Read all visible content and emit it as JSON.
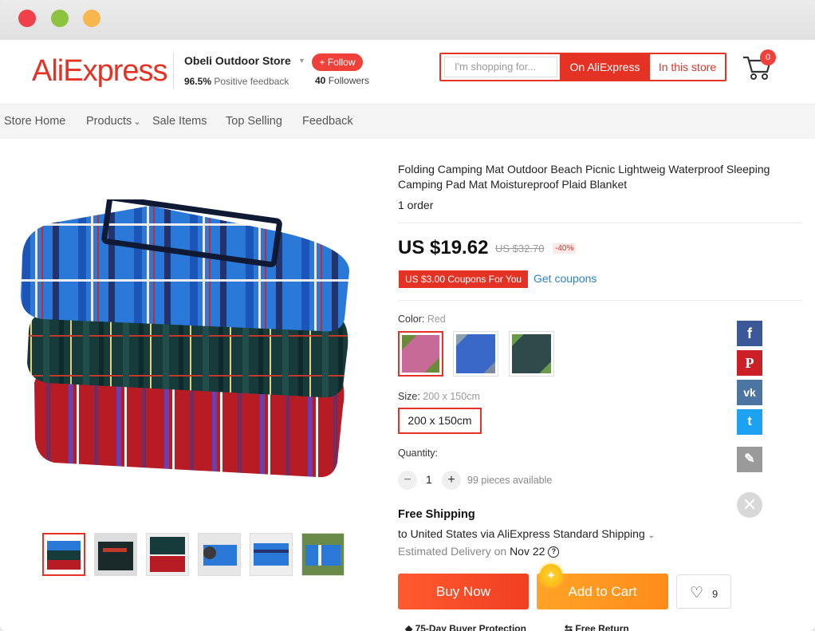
{
  "header": {
    "logo": "AliExpress",
    "store_name": "Obeli Outdoor Store",
    "follow_label": "+ Follow",
    "feedback_percent": "96.5%",
    "feedback_text": "Positive feedback",
    "followers_count": "40",
    "followers_text": "Followers",
    "search_placeholder": "I'm shopping for...",
    "search_on_ali": "On AliExpress",
    "search_in_store": "In this store",
    "cart_count": "0"
  },
  "nav": {
    "items": [
      "Store Home",
      "Products",
      "Sale Items",
      "Top Selling",
      "Feedback"
    ]
  },
  "product": {
    "title": "Folding Camping Mat Outdoor Beach Picnic Lightweig Waterproof Sleeping Camping Pad Mat Moistureproof Plaid Blanket",
    "orders": "1 order",
    "price": "US $19.62",
    "old_price": "US $32.70",
    "discount": "-40%",
    "coupon_tag": "US $3.00 Coupons For You",
    "get_coupons": "Get coupons",
    "color_label": "Color:",
    "color_value": "Red",
    "size_label": "Size:",
    "size_value": "200 x 150cm",
    "size_option": "200 x 150cm",
    "quantity_label": "Quantity:",
    "quantity_minus": "−",
    "quantity": "1",
    "quantity_plus": "+",
    "available": "99 pieces available"
  },
  "shipping": {
    "title": "Free Shipping",
    "to": "to United States via AliExpress Standard Shipping",
    "est_label": "Estimated Delivery on",
    "est_date": "Nov 22",
    "help": "?"
  },
  "actions": {
    "buy_now": "Buy Now",
    "add_to_cart": "Add to Cart",
    "wishlist_count": "9"
  },
  "protection": {
    "buyer": "75-Day Buyer Protection",
    "return": "Free Return"
  },
  "social": [
    "f",
    "P",
    "vk",
    "t",
    "✎"
  ],
  "colors": {
    "accent": "#e43225",
    "facebook": "#3b5998",
    "pinterest": "#cb2027",
    "vk": "#4c75a3",
    "twitter": "#1da1f2"
  }
}
